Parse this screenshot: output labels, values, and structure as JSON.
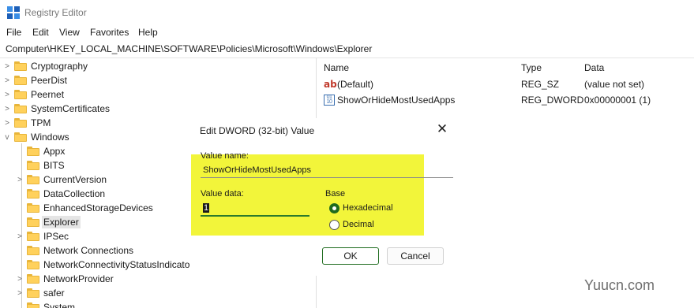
{
  "window": {
    "title": "Registry Editor"
  },
  "menu": {
    "items": [
      "File",
      "Edit",
      "View",
      "Favorites",
      "Help"
    ]
  },
  "address_bar": {
    "path": "Computer\\HKEY_LOCAL_MACHINE\\SOFTWARE\\Policies\\Microsoft\\Windows\\Explorer"
  },
  "tree": {
    "items": [
      {
        "label": "Cryptography",
        "expander": ">"
      },
      {
        "label": "PeerDist",
        "expander": ">"
      },
      {
        "label": "Peernet",
        "expander": ">"
      },
      {
        "label": "SystemCertificates",
        "expander": ">"
      },
      {
        "label": "TPM",
        "expander": ">"
      },
      {
        "label": "Windows",
        "expander": "v"
      },
      {
        "label": "Appx",
        "expander": ""
      },
      {
        "label": "BITS",
        "expander": ""
      },
      {
        "label": "CurrentVersion",
        "expander": ">"
      },
      {
        "label": "DataCollection",
        "expander": ""
      },
      {
        "label": "EnhancedStorageDevices",
        "expander": ""
      },
      {
        "label": "Explorer",
        "expander": "",
        "selected": true
      },
      {
        "label": "IPSec",
        "expander": ">"
      },
      {
        "label": "Network Connections",
        "expander": ""
      },
      {
        "label": "NetworkConnectivityStatusIndicator",
        "expander": ""
      },
      {
        "label": "NetworkProvider",
        "expander": ">"
      },
      {
        "label": "safer",
        "expander": ">"
      },
      {
        "label": "System",
        "expander": ""
      }
    ]
  },
  "values_list": {
    "columns": {
      "name": "Name",
      "type": "Type",
      "data": "Data"
    },
    "rows": [
      {
        "icon": "string-value-icon",
        "name": "(Default)",
        "type": "REG_SZ",
        "data": "(value not set)"
      },
      {
        "icon": "dword-value-icon",
        "name": "ShowOrHideMostUsedApps",
        "type": "REG_DWORD",
        "data": "0x00000001 (1)"
      }
    ]
  },
  "dialog": {
    "title": "Edit DWORD (32-bit) Value",
    "close_glyph": "✕",
    "value_name_label": "Value name:",
    "value_name": "ShowOrHideMostUsedApps",
    "value_data_label": "Value data:",
    "value_data": "1",
    "base_label": "Base",
    "base_options": [
      {
        "label": "Hexadecimal",
        "selected": true
      },
      {
        "label": "Decimal",
        "selected": false
      }
    ],
    "ok_label": "OK",
    "cancel_label": "Cancel"
  },
  "watermark": "Yuucn.com",
  "colors": {
    "highlight": "#f2f53a",
    "accent": "#1e6b1e",
    "folder": "#ffd15c"
  }
}
